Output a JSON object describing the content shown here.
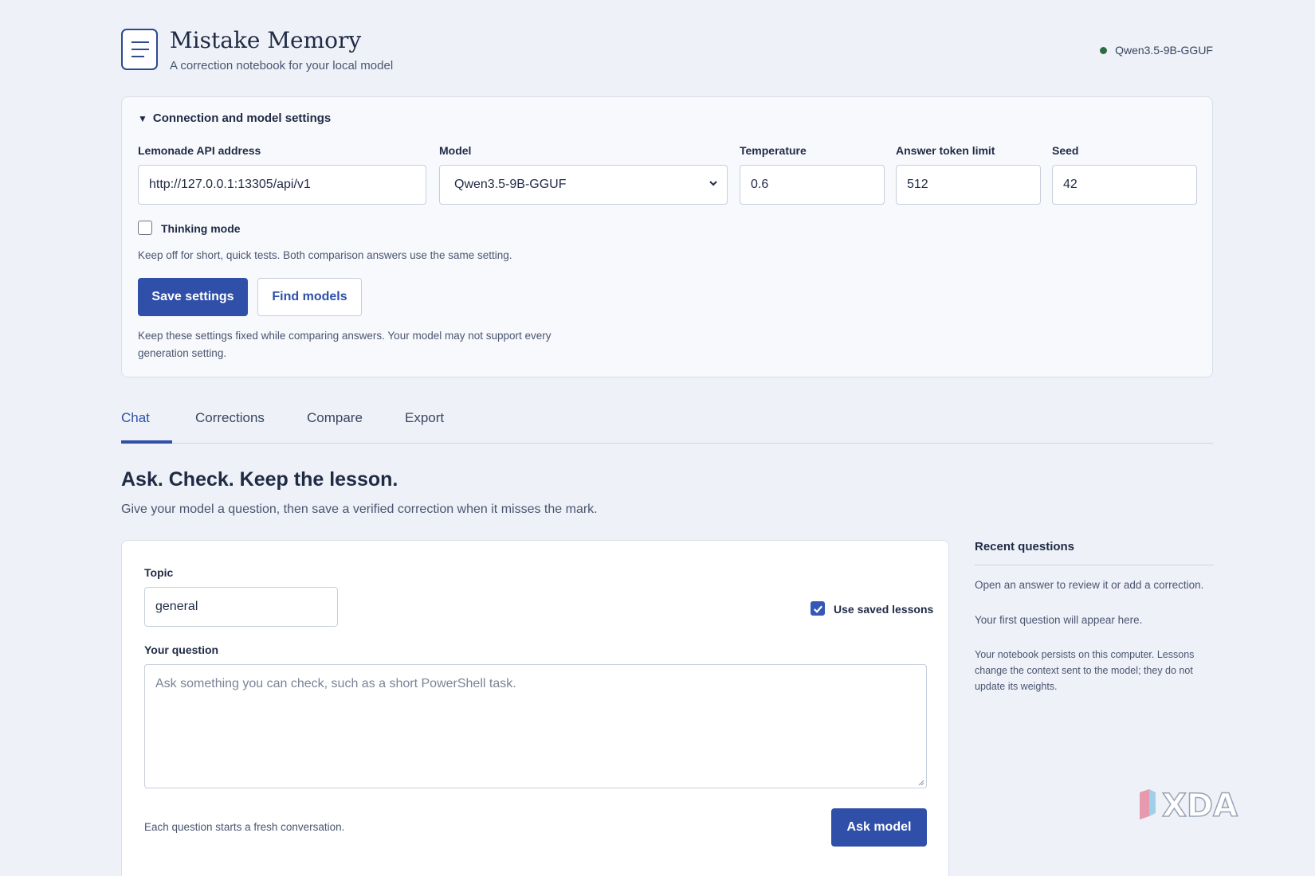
{
  "header": {
    "title": "Mistake Memory",
    "subtitle": "A correction notebook for your local model",
    "status_model": "Qwen3.5-9B-GGUF",
    "status_color": "#2e6b45"
  },
  "settings": {
    "summary": "Connection and model settings",
    "api_label": "Lemonade API address",
    "api_value": "http://127.0.0.1:13305/api/v1",
    "model_label": "Model",
    "model_value": "Qwen3.5-9B-GGUF",
    "temperature_label": "Temperature",
    "temperature_value": "0.6",
    "token_label": "Answer token limit",
    "token_value": "512",
    "seed_label": "Seed",
    "seed_value": "42",
    "thinking_label": "Thinking mode",
    "thinking_checked": false,
    "thinking_hint": "Keep off for short, quick tests. Both comparison answers use the same setting.",
    "save_label": "Save settings",
    "find_label": "Find models",
    "note_line1": "Keep these settings fixed while comparing answers. Your model may not support every",
    "note_line2": "generation setting."
  },
  "tabs": [
    {
      "label": "Chat",
      "active": true
    },
    {
      "label": "Corrections",
      "active": false
    },
    {
      "label": "Compare",
      "active": false
    },
    {
      "label": "Export",
      "active": false
    }
  ],
  "main": {
    "title": "Ask. Check. Keep the lesson.",
    "description": "Give your model a question, then save a verified correction when it misses the mark."
  },
  "ask": {
    "topic_label": "Topic",
    "topic_value": "general",
    "use_lessons_label": "Use saved lessons",
    "use_lessons_checked": true,
    "question_label": "Your question",
    "question_placeholder": "Ask something you can check, such as a short PowerShell task.",
    "footer_hint": "Each question starts a fresh conversation.",
    "ask_label": "Ask model"
  },
  "sidebar": {
    "title": "Recent questions",
    "intro_line": "Open an answer to review it or add a correction.",
    "empty_text": "Your first question will appear here.",
    "note": "Your notebook persists on this computer. Lessons change the context sent to the model; they do not update its weights."
  },
  "colors": {
    "accent": "#2f4fa8",
    "background": "#eef1f7"
  },
  "watermark": {
    "text": "XDA"
  }
}
